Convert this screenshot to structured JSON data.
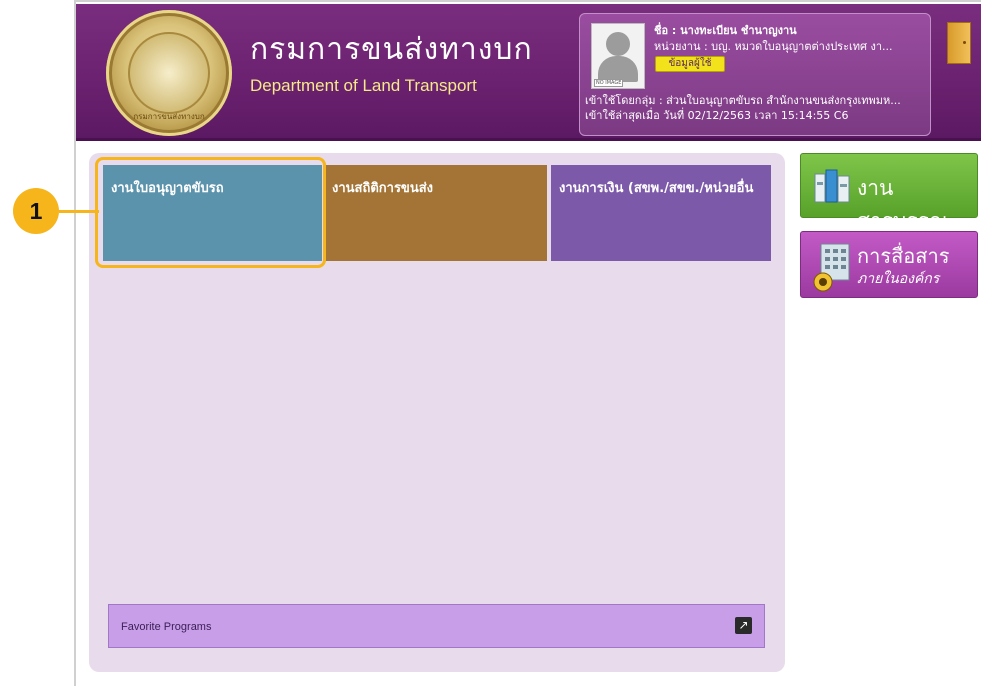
{
  "header": {
    "brand_thai": "กรมการขนส่งทางบก",
    "brand_english": "Department of Land Transport",
    "seal_text": "กรมการขนส่งทางบก"
  },
  "user": {
    "name_line": "ชื่อ : นางทะเบียน ชำนาญงาน",
    "unit_line": "หน่วยงาน : บญ. หมวดใบอนุญาตต่างประเทศ งา...",
    "profile_button": "ข้อมูลผู้ใช้",
    "group_line": "เข้าใช้โดยกลุ่ม : ส่วนใบอนุญาตขับรถ สำนักงานขนส่งกรุงเทพมห...",
    "last_login_line": "เข้าใช้ล่าสุดเมื่อ วันที่ 02/12/2563 เวลา 15:14:55 C6",
    "avatar_placeholder": "NO IMAGE"
  },
  "tiles": [
    {
      "label": "งานใบอนุญาตขับรถ",
      "color": "#5b93ac"
    },
    {
      "label": "งานสถิติการขนส่ง",
      "color": "#a37436"
    },
    {
      "label": "งานการเงิน (สขพ./สขข./หน่วยอื่น",
      "color": "#7d5aa9"
    }
  ],
  "callout": {
    "number": "1",
    "color": "#f5b51b"
  },
  "favorites": {
    "label": "Favorite Programs"
  },
  "side_buttons": {
    "saraban": {
      "label": "งานสารบรรณ",
      "color": "#58a22a"
    },
    "communication": {
      "label": "การสื่อสาร",
      "sublabel": "ภายในองค์กร",
      "color": "#9b3aa0"
    }
  },
  "colors": {
    "header_purple": "#6a216f",
    "panel": "#e8dcec",
    "accent_gold": "#f5e98a"
  }
}
